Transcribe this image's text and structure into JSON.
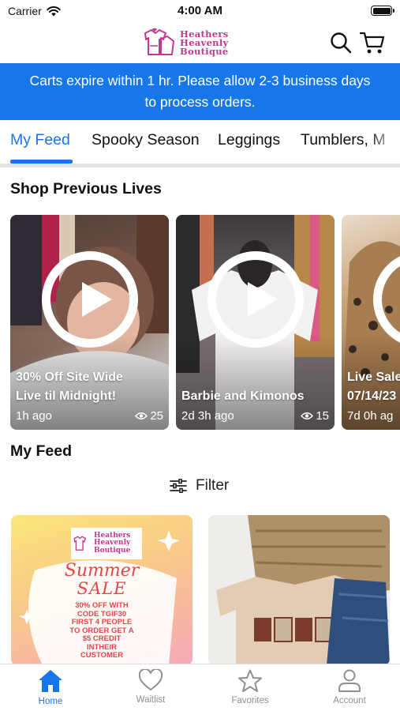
{
  "status_bar": {
    "carrier": "Carrier",
    "time": "4:00 AM"
  },
  "header": {
    "logo_lines": [
      "Heathers",
      "Heavenly",
      "Boutique"
    ],
    "icons": [
      "search-icon",
      "cart-icon"
    ]
  },
  "banner": {
    "line1": "Carts expire within 1 hr. Please allow 2-3 business days",
    "line2": "to process orders."
  },
  "tabs": [
    {
      "label": "My Feed",
      "active": true
    },
    {
      "label": "Spooky Season",
      "active": false
    },
    {
      "label": "Leggings",
      "active": false
    },
    {
      "label": "Tumblers, M",
      "active": false
    }
  ],
  "previous_lives": {
    "title": "Shop Previous Lives",
    "items": [
      {
        "title_line1": "30% Off Site Wide",
        "title_line2": "Live til Midnight!",
        "age": "1h ago",
        "views": "25"
      },
      {
        "title_line1": "Barbie and Kimonos",
        "title_line2": "",
        "age": "2d 3h ago",
        "views": "15"
      },
      {
        "title_line1": "Live Sale",
        "title_line2": "07/14/23",
        "age": "7d 0h ag",
        "views": ""
      }
    ]
  },
  "feed": {
    "title": "My Feed",
    "filter_label": "Filter",
    "promo": {
      "logo_lines": [
        "Heathers",
        "Heavenly",
        "Boutique"
      ],
      "headline1": "Summer",
      "headline2": "SALE",
      "body": [
        "30% OFF WITH",
        "CODE TGIF30",
        "FIRST 4 PEOPLE",
        "TO ORDER GET A",
        "$5 CREDIT",
        "INTHEIR",
        "CUSTOMER"
      ]
    },
    "product": {
      "shirt_text": "MAMA"
    }
  },
  "tabbar": [
    {
      "label": "Home",
      "icon": "home-icon",
      "active": true
    },
    {
      "label": "Waitlist",
      "icon": "heart-icon",
      "active": false
    },
    {
      "label": "Favorites",
      "icon": "star-icon",
      "active": false
    },
    {
      "label": "Account",
      "icon": "person-icon",
      "active": false
    }
  ],
  "colors": {
    "accent": "#1877e8",
    "brand": "#c2378f",
    "banner_text": "#ffffff",
    "inactive": "#8e8e93"
  }
}
